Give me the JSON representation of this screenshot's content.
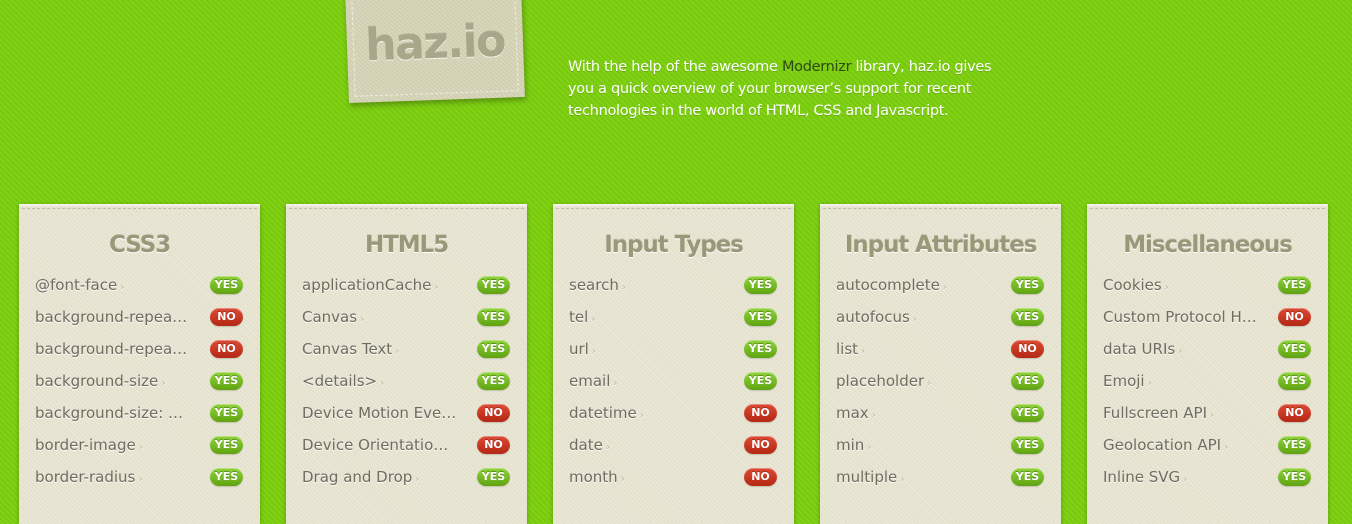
{
  "logo": {
    "text": "haz.io"
  },
  "intro": {
    "before": "With the help of the awesome ",
    "link": "Modernizr",
    "after": " library, haz.io gives you a quick overview of your browser’s support for recent technologies in the world of HTML, CSS and Javascript."
  },
  "colors": {
    "background": "#7ccf0e",
    "panel": "#e9e6d3",
    "yes": "#6ab51b",
    "no": "#c7331c"
  },
  "chevron_glyph": "›",
  "panels": [
    {
      "title": "CSS3",
      "items": [
        {
          "name": "@font-face",
          "status": "YES"
        },
        {
          "name": "background-repeat: round",
          "status": "NO"
        },
        {
          "name": "background-repeat: space",
          "status": "NO"
        },
        {
          "name": "background-size",
          "status": "YES"
        },
        {
          "name": "background-size: cover",
          "status": "YES"
        },
        {
          "name": "border-image",
          "status": "YES"
        },
        {
          "name": "border-radius",
          "status": "YES"
        }
      ]
    },
    {
      "title": "HTML5",
      "items": [
        {
          "name": "applicationCache",
          "status": "YES"
        },
        {
          "name": "Canvas",
          "status": "YES"
        },
        {
          "name": "Canvas Text",
          "status": "YES"
        },
        {
          "name": "<details>",
          "status": "YES"
        },
        {
          "name": "Device Motion Events",
          "status": "NO"
        },
        {
          "name": "Device Orientation Events",
          "status": "NO"
        },
        {
          "name": "Drag and Drop",
          "status": "YES"
        }
      ]
    },
    {
      "title": "Input Types",
      "items": [
        {
          "name": "search",
          "status": "YES"
        },
        {
          "name": "tel",
          "status": "YES"
        },
        {
          "name": "url",
          "status": "YES"
        },
        {
          "name": "email",
          "status": "YES"
        },
        {
          "name": "datetime",
          "status": "NO"
        },
        {
          "name": "date",
          "status": "NO"
        },
        {
          "name": "month",
          "status": "NO"
        }
      ]
    },
    {
      "title": "Input Attributes",
      "items": [
        {
          "name": "autocomplete",
          "status": "YES"
        },
        {
          "name": "autofocus",
          "status": "YES"
        },
        {
          "name": "list",
          "status": "NO"
        },
        {
          "name": "placeholder",
          "status": "YES"
        },
        {
          "name": "max",
          "status": "YES"
        },
        {
          "name": "min",
          "status": "YES"
        },
        {
          "name": "multiple",
          "status": "YES"
        }
      ]
    },
    {
      "title": "Miscellaneous",
      "items": [
        {
          "name": "Cookies",
          "status": "YES"
        },
        {
          "name": "Custom Protocol Handlers",
          "status": "NO"
        },
        {
          "name": "data URIs",
          "status": "YES"
        },
        {
          "name": "Emoji",
          "status": "YES"
        },
        {
          "name": "Fullscreen API",
          "status": "NO"
        },
        {
          "name": "Geolocation API",
          "status": "YES"
        },
        {
          "name": "Inline SVG",
          "status": "YES"
        }
      ]
    }
  ]
}
